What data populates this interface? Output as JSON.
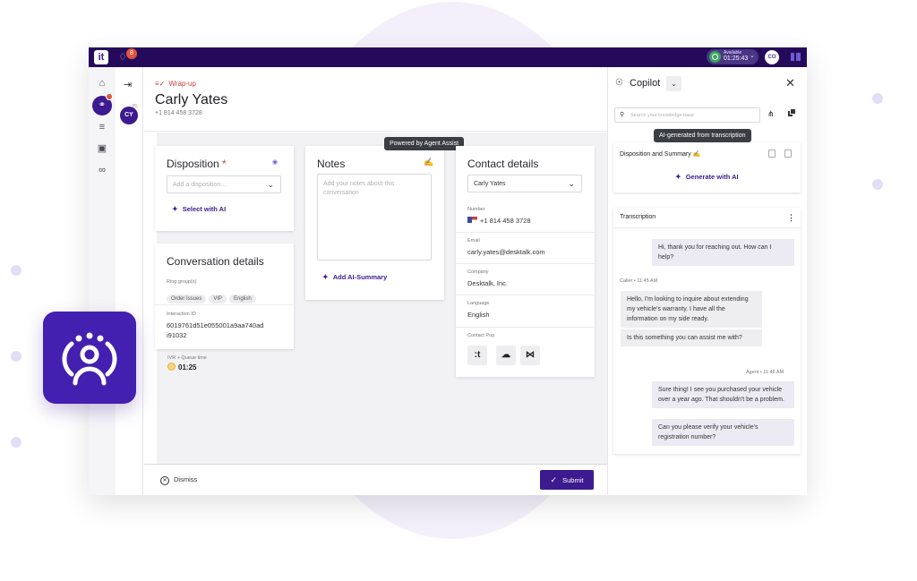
{
  "topbar": {
    "logo": "it",
    "notification_count": "8",
    "status_label": "Available",
    "status_timer": "01:25:43",
    "user_initials": "CO"
  },
  "rail": {
    "active_badge": ""
  },
  "subrail": {
    "avatar_initials": "CY",
    "avatar_badge": "PL"
  },
  "header": {
    "state_label": "Wrap-up",
    "contact_name": "Carly Yates",
    "contact_phone": "+1 814 458 3728"
  },
  "disposition": {
    "title": "Disposition",
    "required_marker": "*",
    "placeholder": "Add a disposition...",
    "ai_action": "Select with AI"
  },
  "conversation": {
    "title": "Conversation details",
    "ring_groups_label": "Ring group(s)",
    "ring_groups": [
      "Order Issues",
      "VIP",
      "English"
    ],
    "interaction_id_label": "Interaction ID",
    "interaction_id": "6019761d51e055001a9aa740ad\ni91032",
    "queue_label": "IVR + Queue time",
    "queue_time": "01:25"
  },
  "notes": {
    "title": "Notes",
    "placeholder": "Add your notes about this conversation",
    "ai_action": "Add AI-Summary",
    "tooltip": "Powered by Agent Assist"
  },
  "contact_details": {
    "title": "Contact details",
    "selected_contact": "Carly Yates",
    "number_label": "Number",
    "number": "+1 814 458 3728",
    "email_label": "Email",
    "email": "carly.yates@desktalk.com",
    "company_label": "Company",
    "company": "Desktalk, Inc.",
    "language_label": "Language",
    "language": "English",
    "contact_pop_label": "Contact Pop",
    "contact_pop_apps": [
      "talkdesk",
      "salesforce",
      "zendesk"
    ]
  },
  "footer": {
    "dismiss_label": "Dismiss",
    "submit_label": "Submit"
  },
  "copilot": {
    "title": "Copilot",
    "search_placeholder": "Search your knowledge base",
    "tooltip": "AI-generated from transcription",
    "summary_title": "Disposition and Summary",
    "generate_label": "Generate with AI",
    "transcription_title": "Transcription",
    "messages": [
      {
        "speaker": "agent",
        "meta": "",
        "text": "Hi, thank you for reaching out. How can I help?"
      },
      {
        "speaker": "caller",
        "meta": "Caller • 11:45 AM",
        "text": "Hello, I'm looking to inquire about extending my vehicle's warranty. I have all the information on my side ready."
      },
      {
        "speaker": "caller",
        "meta": "",
        "text": "Is this something you can assist me with?"
      },
      {
        "speaker": "agent",
        "meta": "Agent • 11:46 AM",
        "text": "Sure thing! I see you purchased your vehicle over a year ago. That shouldn't be a problem."
      },
      {
        "speaker": "agent",
        "meta": "",
        "text": "Can you please verify your vehicle's registration number?"
      }
    ]
  },
  "colors": {
    "brand_purple": "#3c1a8f",
    "topbar": "#250a5c",
    "alert_red": "#e0553c",
    "available_green": "#3aa55c"
  }
}
